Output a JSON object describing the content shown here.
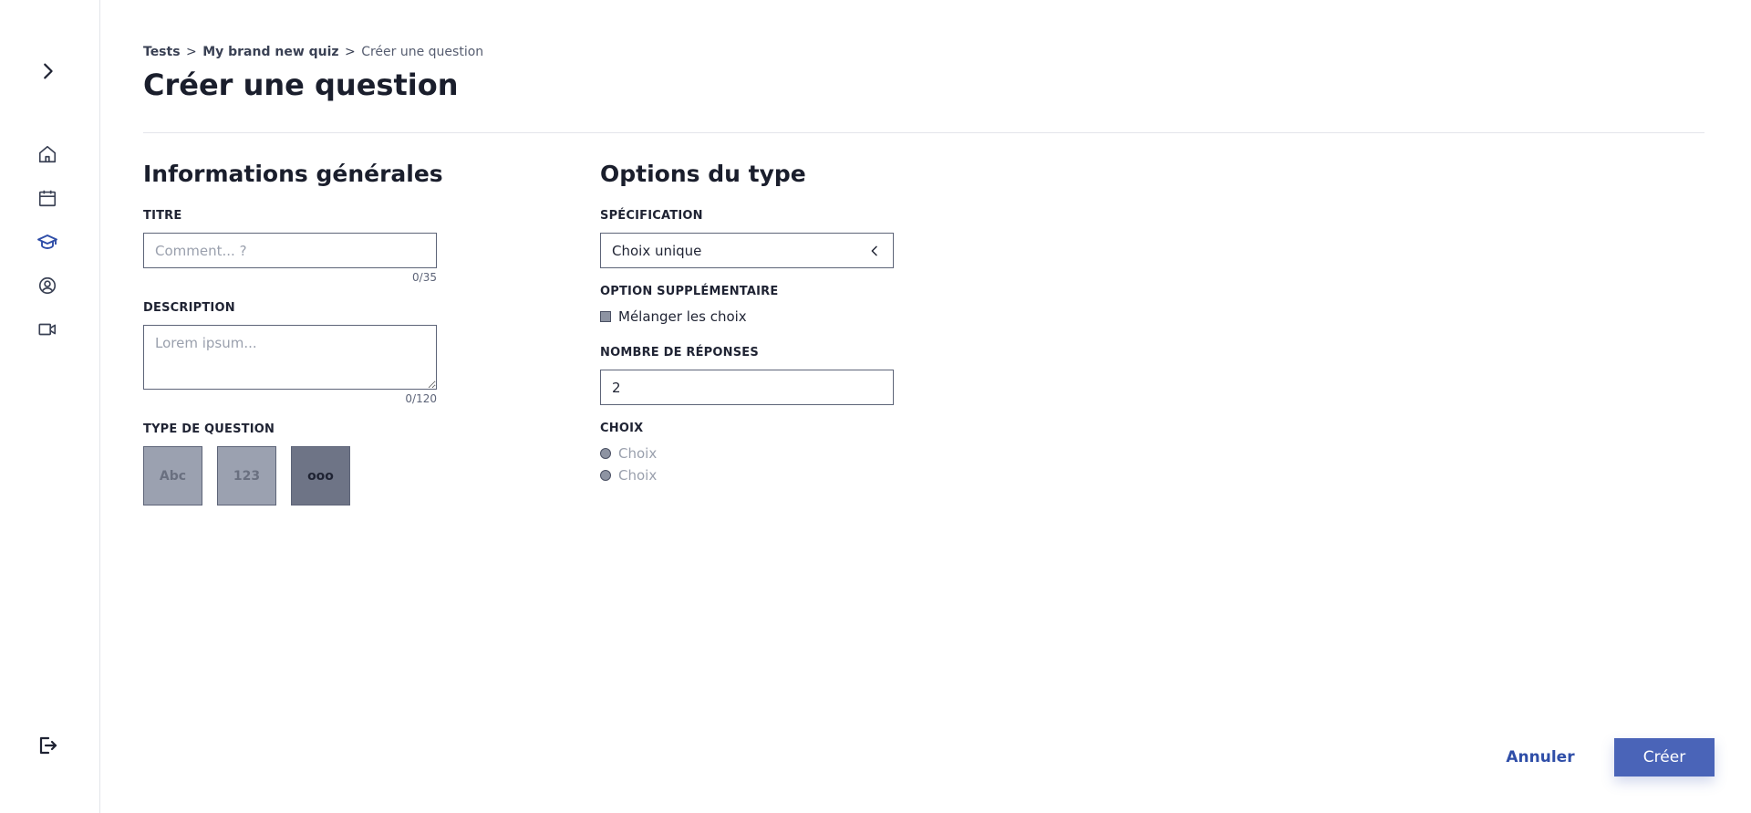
{
  "sidebar": {
    "items": [
      {
        "icon": "chevron-right-icon"
      },
      {
        "icon": "home-icon"
      },
      {
        "icon": "calendar-icon"
      },
      {
        "icon": "graduation-cap-icon",
        "active": true
      },
      {
        "icon": "user-circle-icon"
      },
      {
        "icon": "video-icon"
      },
      {
        "icon": "logout-icon"
      }
    ],
    "active_color": "#2f4ea8"
  },
  "breadcrumb": {
    "items": [
      "Tests",
      "My brand new quiz"
    ],
    "separator": ">",
    "current": "Créer une question"
  },
  "page": {
    "title": "Créer une question"
  },
  "general": {
    "title": "Informations générales",
    "titre": {
      "label": "TITRE",
      "placeholder": "Comment... ?",
      "value": "",
      "counter": "0/35"
    },
    "description": {
      "label": "DESCRIPTION",
      "placeholder": "Lorem ipsum...",
      "value": "",
      "counter": "0/120"
    },
    "question_type": {
      "label": "TYPE DE QUESTION",
      "options": [
        "Abc",
        "123",
        "ooo"
      ],
      "selected": "ooo"
    }
  },
  "type_options": {
    "title": "Options du type",
    "specification": {
      "label": "SPÉCIFICATION",
      "value": "Choix unique"
    },
    "extra_option": {
      "label": "OPTION SUPPLÉMENTAIRE",
      "checkbox_label": "Mélanger les choix",
      "checked": false
    },
    "answers_count": {
      "label": "NOMBRE DE RÉPONSES",
      "value": "2"
    },
    "choices": {
      "label": "CHOIX",
      "items": [
        "Choix",
        "Choix"
      ]
    }
  },
  "actions": {
    "cancel": "Annuler",
    "create": "Créer"
  },
  "colors": {
    "accent": "#4a64b8",
    "link": "#2f4ea8",
    "border": "#5d6478"
  }
}
